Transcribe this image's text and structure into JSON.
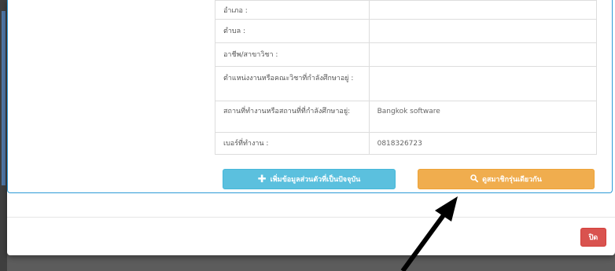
{
  "table": {
    "rows": [
      {
        "label": "อำเภอ :",
        "value": ""
      },
      {
        "label": "ตำบล :",
        "value": ""
      },
      {
        "label": "อาชีพ/สาขาวิชา :",
        "value": ""
      },
      {
        "label": "ตำแหน่งงานหรือคณะวิชาที่กำลังศึกษาอยู่ :",
        "value": ""
      },
      {
        "label": "สถานที่ทำงานหรือสถานที่ที่กำลังศึกษาอยู่:",
        "value": "Bangkok software"
      },
      {
        "label": "เบอร์ที่ทำงาน :",
        "value": "0818326723"
      }
    ]
  },
  "buttons": {
    "add_info": "เพิ่มข้อมูลส่วนตัวที่เป็นปัจจุบัน",
    "view_members": "ดูสมาชิกรุ่นเดียวกัน",
    "close": "ปิด"
  },
  "icons": {
    "add_info": "plus-icon",
    "view_members": "search-icon"
  },
  "colors": {
    "info": "#5bc0de",
    "warning": "#f0ad4e",
    "danger": "#d9534f",
    "panel_border": "#2e9bd6"
  }
}
